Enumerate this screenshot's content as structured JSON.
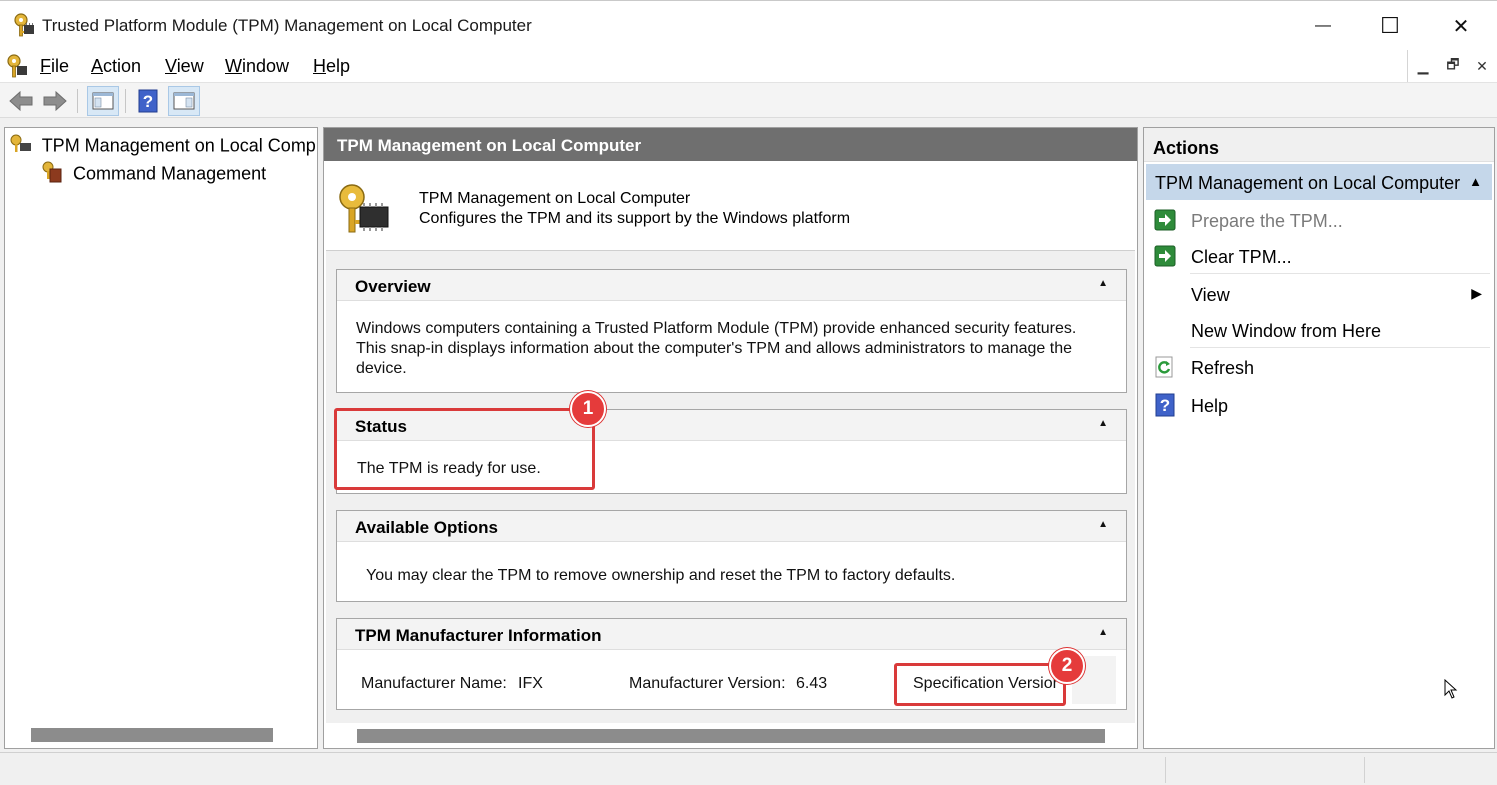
{
  "window": {
    "title": "Trusted Platform Module (TPM) Management on Local Computer",
    "minimize_glyph": "—",
    "maximize_glyph": "☐",
    "close_glyph": "✕"
  },
  "menubar": {
    "items": [
      {
        "label": "File",
        "accel": "F",
        "rest": "ile"
      },
      {
        "label": "Action",
        "accel": "A",
        "rest": "ction"
      },
      {
        "label": "View",
        "accel": "V",
        "rest": "iew"
      },
      {
        "label": "Window",
        "accel": "W",
        "rest": "indow"
      },
      {
        "label": "Help",
        "accel": "H",
        "rest": "elp"
      }
    ]
  },
  "tree": {
    "root": "TPM Management on Local Compu",
    "child": "Command Management"
  },
  "center": {
    "header": "TPM Management on Local Computer",
    "intro_title": "TPM Management on Local Computer",
    "intro_desc": "Configures the TPM and its support by the Windows platform",
    "overview": {
      "title": "Overview",
      "line1": "Windows computers containing a Trusted Platform Module (TPM) provide enhanced security features.",
      "line2": "This snap-in displays information about the computer's TPM and allows administrators to manage the",
      "line3": "device."
    },
    "status": {
      "title": "Status",
      "text": "The TPM is ready for use."
    },
    "options": {
      "title": "Available Options",
      "text": "You may clear the TPM to remove ownership and reset the TPM to factory defaults."
    },
    "manufacturer": {
      "title": "TPM Manufacturer Information",
      "name_label": "Manufacturer Name:",
      "name_value": "IFX",
      "version_label": "Manufacturer Version:",
      "version_value": "6.43",
      "spec_label": "Specification Version:"
    }
  },
  "callouts": {
    "badge1": "1",
    "badge2": "2"
  },
  "actions": {
    "header": "Actions",
    "group": "TPM Management on Local Computer",
    "items": [
      {
        "label": "Prepare the TPM...",
        "enabled": false
      },
      {
        "label": "Clear TPM...",
        "enabled": true
      },
      {
        "label": "View",
        "submenu": true
      },
      {
        "label": "New Window from Here"
      },
      {
        "label": "Refresh"
      },
      {
        "label": "Help"
      }
    ]
  },
  "colors": {
    "accent_callout": "#d93a3a",
    "header_gray": "#6f6f6f",
    "selection_blue": "#c5d7ea"
  }
}
